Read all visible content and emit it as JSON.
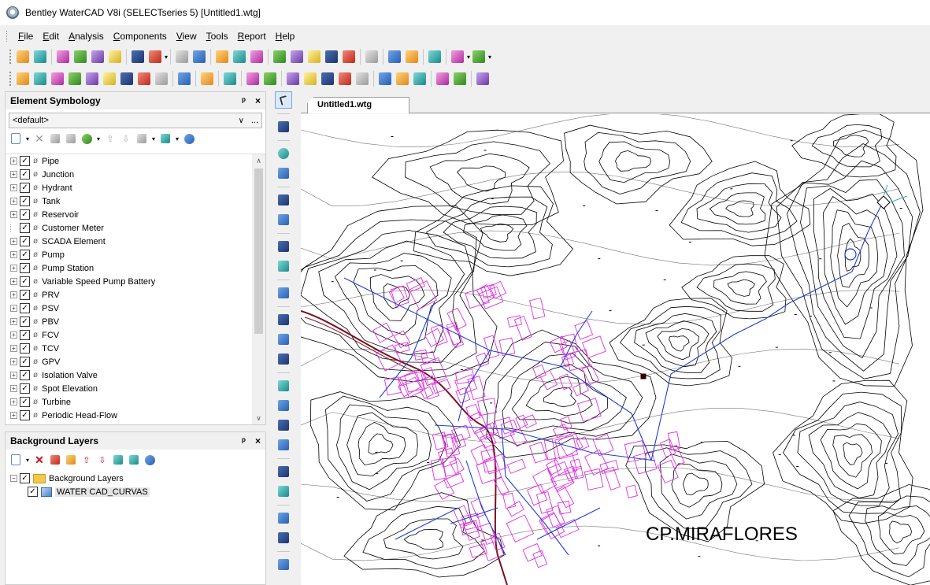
{
  "window": {
    "title": "Bentley WaterCAD V8i (SELECTseries 5) [Untitled1.wtg]"
  },
  "menu": [
    {
      "key": "F",
      "rest": "ile"
    },
    {
      "key": "E",
      "rest": "dit"
    },
    {
      "key": "A",
      "rest": "nalysis"
    },
    {
      "key": "C",
      "rest": "omponents"
    },
    {
      "key": "V",
      "rest": "iew"
    },
    {
      "key": "T",
      "rest": "ools"
    },
    {
      "key": "R",
      "rest": "eport"
    },
    {
      "key": "H",
      "rest": "elp"
    }
  ],
  "symbology": {
    "title": "Element Symbology",
    "pin": "ᵖ",
    "close": "×",
    "combo_value": "<default>",
    "combo_more": "...",
    "items": [
      {
        "label": "Pipe",
        "expandable": true
      },
      {
        "label": "Junction",
        "expandable": true
      },
      {
        "label": "Hydrant",
        "expandable": true
      },
      {
        "label": "Tank",
        "expandable": true
      },
      {
        "label": "Reservoir",
        "expandable": true
      },
      {
        "label": "Customer Meter",
        "expandable": false
      },
      {
        "label": "SCADA Element",
        "expandable": true
      },
      {
        "label": "Pump",
        "expandable": true
      },
      {
        "label": "Pump Station",
        "expandable": true
      },
      {
        "label": "Variable Speed Pump Battery",
        "expandable": true
      },
      {
        "label": "PRV",
        "expandable": true
      },
      {
        "label": "PSV",
        "expandable": true
      },
      {
        "label": "PBV",
        "expandable": true
      },
      {
        "label": "FCV",
        "expandable": true
      },
      {
        "label": "TCV",
        "expandable": true
      },
      {
        "label": "GPV",
        "expandable": true
      },
      {
        "label": "Isolation Valve",
        "expandable": true
      },
      {
        "label": "Spot Elevation",
        "expandable": true
      },
      {
        "label": "Turbine",
        "expandable": true
      },
      {
        "label": "Periodic Head-Flow",
        "expandable": true
      }
    ]
  },
  "background_layers": {
    "title": "Background Layers",
    "pin": "ᵖ",
    "close": "×",
    "root_label": "Background Layers",
    "layer_label": "WATER CAD_CURVAS"
  },
  "document": {
    "tab_label": "Untitled1.wtg",
    "map_label": "CP.MIRAFLORES"
  },
  "colors": {
    "pipe": "#1f3fd6",
    "building": "#e030e0",
    "road": "#7a1020",
    "contour": "#000000"
  },
  "icons": {
    "toolbar1": [
      "undo-icon",
      "redo-icon",
      "zoom-extents-icon",
      "zoom-window-icon",
      "zoom-in-icon",
      "zoom-out-icon",
      "pan-icon",
      "refresh-icon",
      "aerial-view-icon",
      "layer-icon",
      "select-icon",
      "select-by-attribute-icon",
      "query-icon",
      "prototypes-icon",
      "flextable-icon",
      "graph-icon",
      "profile-icon",
      "contour-icon",
      "property-icon",
      "new-icon",
      "open-icon",
      "save-icon",
      "print-preview-icon",
      "print-icon"
    ],
    "toolbar2": [
      "scenario-icon",
      "alternative-icon",
      "calculation-options-icon",
      "patterns-icon",
      "controls-icon",
      "energy-costs-icon",
      "network-navigator-icon",
      "element-symbology-icon",
      "background-layers-icon",
      "validate-icon",
      "compute-icon",
      "user-notifications-icon",
      "fire-flow-icon",
      "criticality-icon",
      "segmentation-icon",
      "darwin-calibrator-icon",
      "darwin-designer-icon",
      "skelebrator-icon",
      "pressure-dependent-icon",
      "scenario-energy-icon",
      "water-quality-icon",
      "trex-icon",
      "loadbuilder-icon",
      "thiessen-icon",
      "help-icon"
    ],
    "vertical": [
      "select-arrow-icon",
      "node-layout-icon",
      "junction-icon",
      "hydrant-icon",
      "tank-icon",
      "reservoir-icon",
      "pump-station-icon",
      "vspb-icon",
      "pump-icon",
      "customer-meter-icon",
      "scada-icon",
      "valve-icon",
      "prv-icon",
      "psv-icon",
      "pbv-icon",
      "fcv-icon",
      "tcv-icon",
      "gpv-icon",
      "spot-elevation-icon",
      "turbine-icon",
      "pipe-layout-icon"
    ]
  }
}
